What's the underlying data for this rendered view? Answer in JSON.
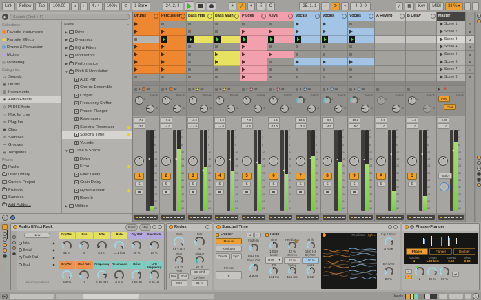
{
  "icons": {
    "menu": "≡",
    "play": "▶",
    "freeze": "∗",
    "swap": "⇄",
    "sine": "~",
    "steps": "^",
    "bell": "△",
    "camera": "⊙",
    "caret": "▾",
    "sort": "▲",
    "headphone": "∩",
    "back": "▶",
    "nudge_l": "◃",
    "nudge_r": "▹",
    "metro": "⊙",
    "pencil": "╱",
    "kbd": "▦",
    "curve": "∩",
    "stopall": "■"
  },
  "transport": {
    "link": "Link",
    "follow": "Follow",
    "tap": "Tap",
    "tempo": "100.00",
    "sig": "4 / 4",
    "groove": "100%",
    "quant": "1 Bar",
    "pos": "24. 3. 4",
    "loop_start": "25. 1. 1",
    "loop_len": "4. 0. 0",
    "key_label": "Key",
    "midi_label": "MIDI",
    "cpu": "33 %"
  },
  "browser": {
    "search_placeholder": "Search (Cmd + F)",
    "collections_header": "Collections",
    "collections": [
      {
        "label": "Favorite Instruments",
        "color": "#ef8730"
      },
      {
        "label": "Favorite Effects",
        "color": "#e8d24a"
      },
      {
        "label": "Drums & Percussion",
        "color": "#6aa1d8"
      },
      {
        "label": "Mixing",
        "color": "#b9a8e0"
      },
      {
        "label": "Mastering",
        "color": "#9a9996"
      }
    ],
    "categories_header": "Categories",
    "categories": [
      {
        "label": "Sounds",
        "icon": "♫"
      },
      {
        "label": "Drums",
        "icon": "▦"
      },
      {
        "label": "Instruments",
        "icon": "▥"
      },
      {
        "label": "Audio Effects",
        "icon": "◈",
        "selected": true
      },
      {
        "label": "MIDI Effects",
        "icon": "◇"
      },
      {
        "label": "Max for Live",
        "icon": "○"
      },
      {
        "label": "Plug-Ins",
        "icon": "▱"
      },
      {
        "label": "Clips",
        "icon": "▣"
      },
      {
        "label": "Samples",
        "icon": "≈"
      },
      {
        "label": "Grooves",
        "icon": "∼"
      },
      {
        "label": "Templates",
        "icon": "▤"
      }
    ],
    "places_header": "Places",
    "places": [
      "Packs",
      "User Library",
      "Current Project",
      "Projects",
      "Samples",
      "Add Folder..."
    ],
    "name_header": "Name",
    "tree": [
      {
        "label": "Drive",
        "depth": 0,
        "arrow": "▶"
      },
      {
        "label": "Dynamics",
        "depth": 0,
        "arrow": "▶"
      },
      {
        "label": "EQ & Filters",
        "depth": 0,
        "arrow": "▶"
      },
      {
        "label": "Modulators",
        "depth": 0,
        "arrow": "▶"
      },
      {
        "label": "Performance",
        "depth": 0,
        "arrow": "▶"
      },
      {
        "label": "Pitch & Modulation",
        "depth": 0,
        "arrow": "▼"
      },
      {
        "label": "Auto Pan",
        "depth": 1
      },
      {
        "label": "Chorus-Ensemble",
        "depth": 1
      },
      {
        "label": "Corpus",
        "depth": 1
      },
      {
        "label": "Frequency Shifter",
        "depth": 1
      },
      {
        "label": "Phaser-Flanger",
        "depth": 1
      },
      {
        "label": "Resonators",
        "depth": 1
      },
      {
        "label": "Spectral Resonator",
        "depth": 1,
        "dot": true
      },
      {
        "label": "Spectral Time",
        "depth": 1,
        "dot": true,
        "selected": true
      },
      {
        "label": "Vocoder",
        "depth": 1
      },
      {
        "label": "Time & Space",
        "depth": 0,
        "arrow": "▼"
      },
      {
        "label": "Delay",
        "depth": 1
      },
      {
        "label": "Echo",
        "depth": 1,
        "dot": true
      },
      {
        "label": "Filter Delay",
        "depth": 1
      },
      {
        "label": "Grain Delay",
        "depth": 1
      },
      {
        "label": "Hybrid Reverb",
        "depth": 1,
        "dot": true
      },
      {
        "label": "Reverb",
        "depth": 1
      },
      {
        "label": "Utilities",
        "depth": 0,
        "arrow": "▶"
      }
    ]
  },
  "session": {
    "sends_label": "Sends",
    "post_label": "Post",
    "solo_label": "Solo",
    "active_row": 3,
    "scale": [
      "6",
      "0",
      "6",
      "12",
      "18",
      "24",
      "30",
      "36",
      "42",
      "48",
      "54",
      "60"
    ],
    "tracks": [
      {
        "name": "Drums",
        "color": "#ef8730",
        "clips": "CCECCCCS",
        "count": "1",
        "len": "32",
        "peak": "-7.2",
        "vol": "-3.5",
        "num": "1",
        "meter": 0.06,
        "fader": 0.36
      },
      {
        "name": "Percussion",
        "color": "#ef8730",
        "clips": "SCPCCCCS",
        "count": "1",
        "len": "32",
        "peak": "-9.2",
        "vol": "-4.0",
        "num": "2",
        "meter": 0.76,
        "fader": 0.36
      },
      {
        "name": "Bass Hits",
        "color": "#e9e160",
        "clips": "SSPSSSSS",
        "count": "1",
        "len": "32",
        "peak": "-13.0",
        "vol": "-14.9",
        "num": "3",
        "meter": 0.55,
        "fader": 0.5
      },
      {
        "name": "Bass Main",
        "color": "#e9e160",
        "clips": "SSPSCCSS",
        "count": "1",
        "len": "40",
        "peak": "-8.0",
        "vol": "-4.0",
        "num": "4",
        "meter": 0.5,
        "fader": 0.37
      },
      {
        "name": "Plucks",
        "color": "#f2a0ae",
        "clips": "SCPCCCCC",
        "count": "1",
        "len": "40",
        "peak": "-7.8",
        "vol": "-5.5",
        "num": "5",
        "meter": 0.58,
        "fader": 0.4
      },
      {
        "name": "Keys",
        "color": "#f2a0ae",
        "clips": "SCPSCSSS",
        "count": "1",
        "len": "40",
        "peak": "-6.5",
        "vol": "-14.0",
        "num": "6",
        "meter": 0.45,
        "fader": 0.5
      },
      {
        "name": "Vocals",
        "color": "#a4c4e6",
        "clips": "CCPSSCSS",
        "count": "1",
        "len": "32",
        "peak": "-13.5",
        "vol": "-3.4",
        "num": "7",
        "meter": 0.68,
        "fader": 0.35
      },
      {
        "name": "Vocals",
        "color": "#a4c4e6",
        "clips": "CCPSSCSS",
        "count": "1",
        "len": "32",
        "peak": "-9.0",
        "vol": "-4.5",
        "num": "8",
        "meter": 0.6,
        "fader": 0.37
      },
      {
        "name": "Vocals",
        "color": "#a4c4e6",
        "clips": "SCPSSCSS",
        "count": "1",
        "len": "32",
        "peak": "-10.2",
        "vol": "-5.0",
        "num": "9",
        "meter": 0.58,
        "fader": 0.37
      }
    ],
    "returns": [
      {
        "name": "A Reverb",
        "num": "A",
        "peak": "-0.9",
        "vol": "0",
        "meter": 0.25,
        "fader": 0.3,
        "dim": "A"
      },
      {
        "name": "B Delay",
        "num": "B",
        "peak": "-4.3",
        "vol": "0",
        "meter": 0.18,
        "fader": 0.3,
        "dim": "B"
      }
    ],
    "master": {
      "name": "Master",
      "peak": "-0.30",
      "vol": "0",
      "meter": 0.85,
      "fader": 0.26,
      "scenes": [
        {
          "label": "Scene 1",
          "num": "1"
        },
        {
          "label": "Scene 2",
          "num": "2"
        },
        {
          "label": "Scene 3",
          "num": "3"
        },
        {
          "label": "Scene 4",
          "num": "4"
        },
        {
          "label": "Scene 5",
          "num": "5"
        },
        {
          "label": "Scene 6",
          "num": "6"
        },
        {
          "label": "Scene 7",
          "num": "7"
        },
        {
          "label": "Scene 8",
          "num": "8"
        }
      ]
    }
  },
  "devices": {
    "rack": {
      "title": "Audio Effect Rack",
      "rand": "Rand",
      "map": "Map",
      "new_label": "New",
      "variations": [
        "Intro",
        "Break",
        "Fade Out",
        "End"
      ],
      "macro_variations_label": "Macro Variations",
      "macros": [
        {
          "label": "Dry/Wet",
          "value": "31 %",
          "color": "#e3df63",
          "fill": 0.31
        },
        {
          "label": "Bits",
          "value": "5",
          "color": "#e3df63",
          "fill": 0.28
        },
        {
          "label": "Jitter",
          "value": "3.6 %",
          "color": "#e3df63",
          "fill": 0.06
        },
        {
          "label": "Rate",
          "value": "14.2 kHz",
          "color": "#e3df63",
          "fill": 0.93
        },
        {
          "label": "Dry Wet",
          "value": "28 %",
          "color": "#b4a8e0",
          "fill": 0.28
        },
        {
          "label": "Feedback",
          "value": "23 %",
          "color": "#b4a8e0",
          "fill": 0.23
        },
        {
          "label": "Dry/Wet",
          "value": "100 %",
          "color": "#f0924f",
          "fill": 1
        },
        {
          "label": "Mod Rate",
          "value": "2",
          "color": "#f0924f",
          "fill": 0.2
        },
        {
          "label": "Frequency",
          "value": "6.30 kHz",
          "color": "#7fccc3",
          "fill": 0.75
        },
        {
          "label": "Resonance",
          "value": "0.0 %",
          "color": "#7fccc3",
          "fill": 0
        },
        {
          "label": "Drive",
          "value": "8.69 dB",
          "color": "#7fccc3",
          "fill": 0.62
        },
        {
          "label": "LFO Frequency",
          "value": "0.26 Hz",
          "color": "#7fccc3",
          "fill": 0.3
        }
      ]
    },
    "redux": {
      "title": "Redux",
      "rate_label": "Rate",
      "rate": "14.2 kHz",
      "bits_label": "Bits",
      "bits": "5",
      "jitter_label": "Jitter",
      "jitter": "3.6 %",
      "shape_label": "Shape",
      "shape": "27 %",
      "filter_label": "Filter",
      "pre": "Pre",
      "post": "Post",
      "filter_value": "0.00",
      "dc": "DC Shift",
      "drywet_label": "Dry/Wet",
      "drywet": "31 %"
    },
    "spectral": {
      "title": "Spectral Time",
      "freezer_label": "Freezer",
      "manual": "Manual",
      "retrigger": "Retrigger",
      "onsets": "Onsets",
      "sync": "Sync",
      "fade_in_label": "Fade In",
      "fade_in": "55.2 ms",
      "fade_out_label": "Fade Out",
      "fade_out": "3.90 s",
      "freeze_label": "Freeze",
      "delay_label": "Delay",
      "time_label": "Time",
      "time": "1.03 s",
      "feedback_label": "Feedback",
      "feedback": "23 %",
      "shift_label": "Shift",
      "shift": "14.0 Hz",
      "mode_label": "Mode",
      "mode": "Time",
      "stereo_label": "Stereo",
      "stereo": "53 %",
      "drywet_label": "Dry/Wet",
      "drywet": "100 %",
      "tilt_label": "Tilt",
      "tilt": "144 ms",
      "spray_label": "Spray",
      "spray": "165 ms",
      "mask_label": "Mask",
      "mask": "0.52",
      "resolution_label": "Resolution",
      "resolution": "High",
      "input_send_label": "Input Send",
      "input_send": "0.0 dB",
      "out_drywet_label": "Dry/Wet",
      "out_drywet": "28 %"
    },
    "phaser": {
      "title": "Phaser-Flanger",
      "modes": [
        "Phaser",
        "Flanger",
        "Doubler"
      ],
      "notches_label": "Notches",
      "notches": "4",
      "center_label": "Center",
      "center": "1.00 kHz",
      "spread_label": "Spread",
      "spread": "0.50",
      "blend_label": "Blend",
      "blend": "0.00",
      "rate_label": "Rate",
      "rate": "2",
      "amount_label": "Amount",
      "amount": "83 %",
      "feedback_label": "Feedback",
      "feedback": "16 %"
    }
  },
  "statusbar": {
    "track": "Vocals"
  }
}
